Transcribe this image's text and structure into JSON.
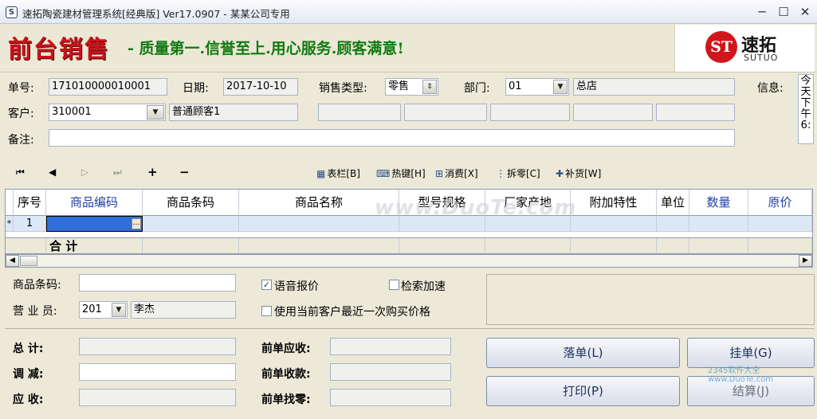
{
  "window": {
    "title": "速拓陶瓷建材管理系统[经典版]  Ver17.0907  -  某某公司专用",
    "app_icon_glyph": "S",
    "controls": {
      "minimize": "─",
      "maximize": "☐",
      "close": "✕"
    }
  },
  "banner": {
    "title": "前台销售",
    "slogan": "- 质量第一.信誉至上.用心服务.顾客满意!",
    "logo": {
      "mark": "ST",
      "name_cn": "速拓",
      "name_en": "SUTUO",
      "color": "#d0161c"
    }
  },
  "form": {
    "order_no": {
      "label": "单号:",
      "value": "171010000010001"
    },
    "date": {
      "label": "日期:",
      "value": "2017-10-10"
    },
    "sale_type": {
      "label": "销售类型:",
      "value": "零售"
    },
    "department": {
      "label": "部门:",
      "value": "01",
      "name": "总店"
    },
    "info": {
      "label": "信息:",
      "column_text": "今天下午6:"
    },
    "customer": {
      "label": "客户:",
      "value": "310001",
      "name": "普通顾客1"
    },
    "remark": {
      "label": "备注:",
      "value": ""
    }
  },
  "toolbar": {
    "nav": {
      "first": "⏮",
      "prev": "◀",
      "next": "▷",
      "last": "⏭",
      "add": "+",
      "remove": "−"
    },
    "buttons": [
      {
        "label": "表栏[B]",
        "icon": "table-icon",
        "glyph": "▦"
      },
      {
        "label": "热键[H]",
        "icon": "keyboard-icon",
        "glyph": "⌨"
      },
      {
        "label": "消费[X]",
        "icon": "consume-icon",
        "glyph": "⊞"
      },
      {
        "label": "拆零[C]",
        "icon": "split-icon",
        "glyph": "⋮"
      },
      {
        "label": "补货[W]",
        "icon": "restock-icon",
        "glyph": "✚"
      }
    ]
  },
  "grid": {
    "columns": [
      "序号",
      "商品编码",
      "商品条码",
      "商品名称",
      "型号规格",
      "厂家产地",
      "附加特性",
      "单位",
      "数量",
      "原价"
    ],
    "rows": [
      {
        "marker": "*",
        "seq": "1"
      }
    ],
    "total_label": "合  计"
  },
  "bottom": {
    "barcode": {
      "label": "商品条码:",
      "value": ""
    },
    "salesperson": {
      "label": "营 业 员:",
      "value": "201",
      "name": "李杰"
    },
    "voice_quote": {
      "label": "语音报价",
      "checked": true
    },
    "search_speed": {
      "label": "检索加速",
      "checked": false
    },
    "last_price": {
      "label": "使用当前客户最近一次购买价格",
      "checked": false
    },
    "total": {
      "label": "总  计:",
      "value": ""
    },
    "adjust": {
      "label": "调  减:",
      "value": ""
    },
    "receivable": {
      "label": "应  收:",
      "value": ""
    },
    "prev_receivable": {
      "label": "前单应收:",
      "value": ""
    },
    "prev_received": {
      "label": "前单收款:",
      "value": ""
    },
    "prev_change": {
      "label": "前单找零:",
      "value": ""
    }
  },
  "actions": {
    "place_order": "落单(L)",
    "hold_order": "挂单(G)",
    "print": "打印(P)",
    "settle": "结算(J)"
  },
  "watermarks": {
    "main": "www.DuoTe.com",
    "corner": "2345软件大全 www.DuoTe.com"
  }
}
